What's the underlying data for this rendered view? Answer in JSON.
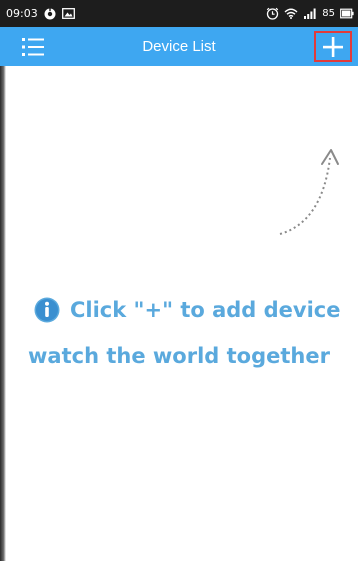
{
  "status_bar": {
    "time": "09:03",
    "battery_level": "85",
    "icons": [
      "location-icon",
      "image-icon",
      "alarm-icon",
      "wifi-icon",
      "signal-icon",
      "battery-icon"
    ]
  },
  "header": {
    "title": "Device List",
    "menu_icon": "menu-icon",
    "add_icon": "plus-icon"
  },
  "empty_state": {
    "icon": "info-icon",
    "line1": "Click \"+\" to add device",
    "line2": "watch the world together"
  },
  "colors": {
    "header_bg": "#3ea7f1",
    "hint_text": "#5aa9dd",
    "add_highlight": "#e23b3b",
    "status_bar_bg": "#1d1d1d"
  }
}
